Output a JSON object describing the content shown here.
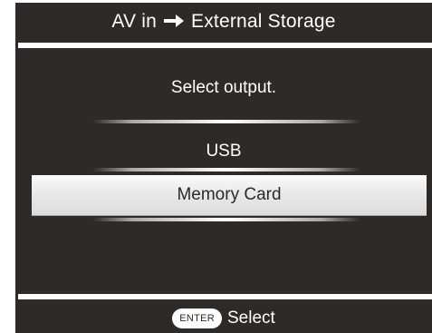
{
  "title": {
    "source": "AV in",
    "arrow_icon": "right-arrow-icon",
    "destination": "External Storage"
  },
  "prompt": "Select output.",
  "options": [
    {
      "label": "USB",
      "selected": false
    },
    {
      "label": "Memory Card",
      "selected": true
    }
  ],
  "footer": {
    "key_label": "ENTER",
    "action_label": "Select"
  },
  "colors": {
    "background": "#2e2a28",
    "text": "#ffffff",
    "highlight": "#e9e9e9"
  }
}
